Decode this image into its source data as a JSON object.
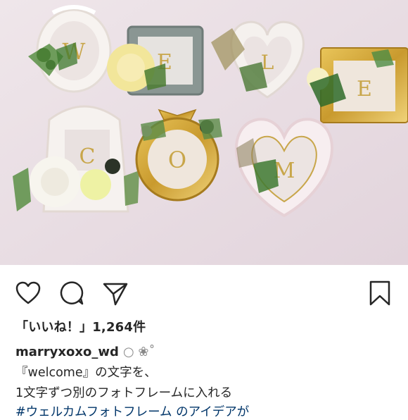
{
  "post": {
    "likes_text": "「いいね！」1,264件",
    "username": "marryxoxo_wd",
    "username_emoji": "○ ❀˚",
    "caption_lines": [
      "『welcome』の文字を、",
      "1文字ずつ別のフォトフレームに入れる",
      "#ウェルカムフォトフレーム のアイデアが"
    ]
  },
  "photo": {
    "frame_letters": [
      "W",
      "E",
      "L",
      "C",
      "O",
      "M",
      "E"
    ]
  },
  "icons": [
    "heart-icon",
    "comment-icon",
    "share-icon",
    "bookmark-icon"
  ],
  "colors": {
    "background": "#ffffff",
    "text": "#262626",
    "hashtag": "#003569",
    "photo_backdrop": "#e9dde3"
  }
}
